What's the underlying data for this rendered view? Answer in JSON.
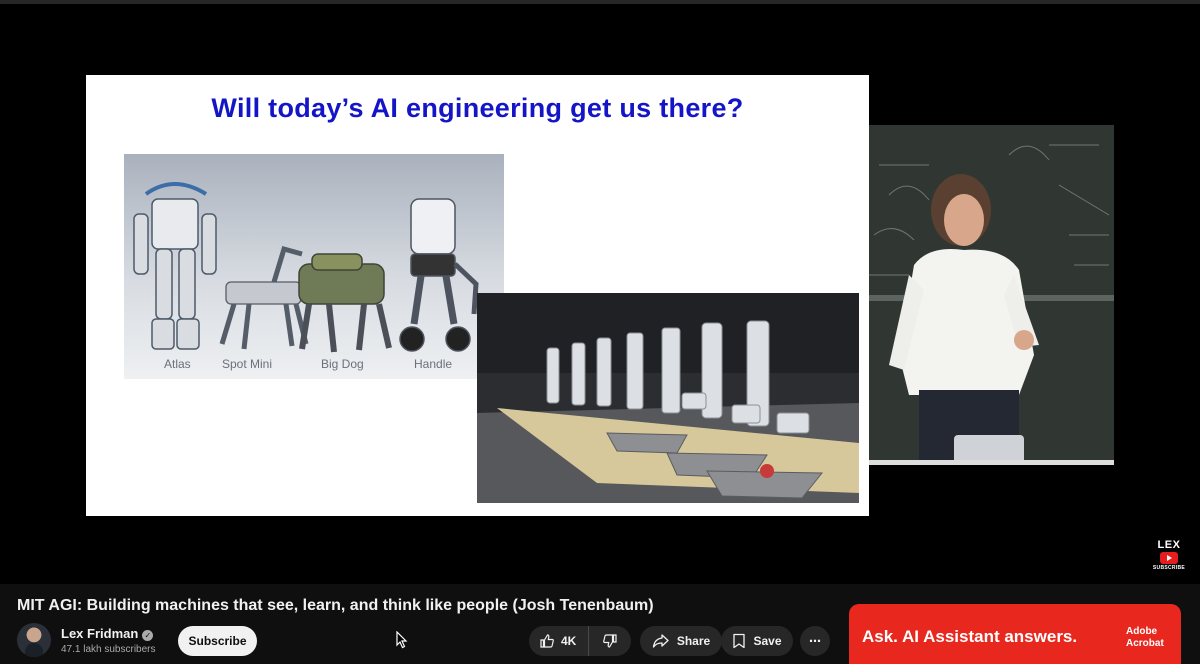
{
  "slide": {
    "title": "Will today’s AI engineering get us there?",
    "robot_labels": [
      "Atlas",
      "Spot Mini",
      "Big Dog",
      "Handle"
    ]
  },
  "channel_watermark": {
    "name": "LEX",
    "action": "SUBSCRIBE"
  },
  "video": {
    "title": "MIT AGI: Building machines that see, learn, and think like people (Josh Tenenbaum)"
  },
  "channel": {
    "name": "Lex Fridman",
    "subscribers": "47.1 lakh subscribers",
    "verified": true
  },
  "actions": {
    "subscribe_label": "Subscribe",
    "like_count": "4K",
    "share_label": "Share",
    "save_label": "Save",
    "more_label": "⋯"
  },
  "ad": {
    "text": "Ask. AI Assistant answers.",
    "brand_line1": "Adobe",
    "brand_line2": "Acrobat",
    "color": "#e8281e"
  },
  "colors": {
    "background": "#0f0f0f",
    "slide_title": "#1515c8",
    "subscribe_bg": "#f1f1f1",
    "pill_bg": "#272727"
  },
  "icons": [
    "verified-check-icon",
    "like-icon",
    "dislike-icon",
    "share-icon",
    "save-icon",
    "more-icon",
    "youtube-play-icon",
    "mouse-cursor-icon"
  ]
}
